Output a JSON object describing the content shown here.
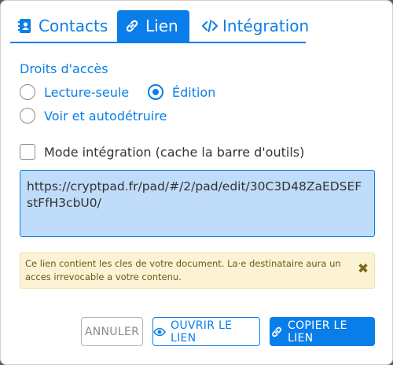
{
  "tabs": [
    {
      "label": "Contacts",
      "icon": "address-book-icon"
    },
    {
      "label": "Lien",
      "icon": "link-icon"
    },
    {
      "label": "Intégration",
      "icon": "code-icon"
    }
  ],
  "access": {
    "title": "Droits d'accès",
    "options": [
      {
        "label": "Lecture-seule",
        "selected": false
      },
      {
        "label": "Édition",
        "selected": true
      },
      {
        "label": "Voir et autodétruire",
        "selected": false
      }
    ]
  },
  "embed": {
    "label": "Mode intégration (cache la barre d'outils)",
    "checked": false
  },
  "link": {
    "url": "https://cryptpad.fr/pad/#/2/pad/edit/30C3D48ZaEDSEFstFfH3cbU0/"
  },
  "alert": {
    "text": "Ce lien contient les cles de votre document. La·e destinataire aura un acces irrevocable a votre contenu.",
    "close_icon": "close-icon"
  },
  "buttons": {
    "cancel": "ANNULER",
    "open": "OUVRIR LE LIEN",
    "copy": "COPIER LE LIEN"
  },
  "colors": {
    "accent": "#0a7ee8",
    "link_bg": "#bfdcfa",
    "alert_bg": "#fcf3d4"
  }
}
